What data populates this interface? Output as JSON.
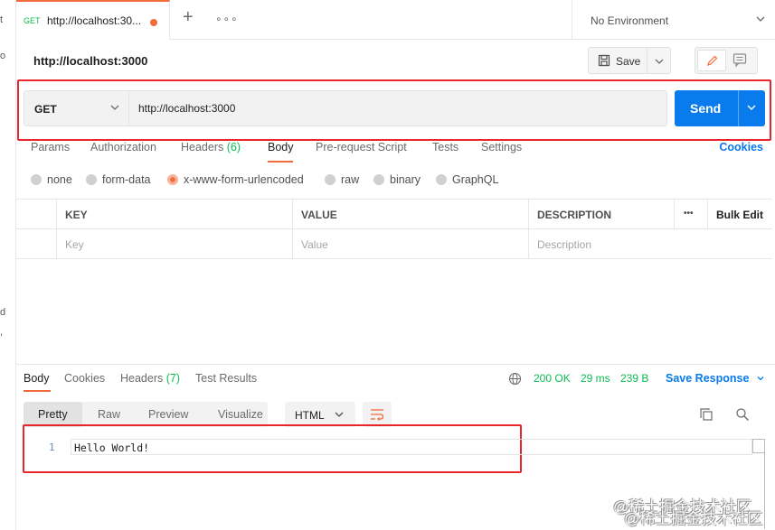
{
  "tab": {
    "method": "GET",
    "title": "http://localhost:30..."
  },
  "environment": {
    "label": "No Environment"
  },
  "request": {
    "title": "http://localhost:3000",
    "save_label": "Save",
    "method": "GET",
    "url": "http://localhost:3000",
    "send_label": "Send"
  },
  "req_tabs": {
    "params": "Params",
    "authorization": "Authorization",
    "headers": "Headers",
    "headers_count": "(6)",
    "body": "Body",
    "prerequest": "Pre-request Script",
    "tests": "Tests",
    "settings": "Settings",
    "cookies": "Cookies"
  },
  "body_types": {
    "none": "none",
    "form_data": "form-data",
    "urlencoded": "x-www-form-urlencoded",
    "raw": "raw",
    "binary": "binary",
    "graphql": "GraphQL",
    "selected": "x-www-form-urlencoded"
  },
  "kv_table": {
    "headers": {
      "key": "KEY",
      "value": "VALUE",
      "description": "DESCRIPTION",
      "more": "•••",
      "bulk": "Bulk Edit"
    },
    "placeholders": {
      "key": "Key",
      "value": "Value",
      "description": "Description"
    }
  },
  "response": {
    "tabs": {
      "body": "Body",
      "cookies": "Cookies",
      "headers": "Headers",
      "headers_count": "(7)",
      "tests": "Test Results"
    },
    "status": "200 OK",
    "time": "29 ms",
    "size": "239 B",
    "save_response": "Save Response",
    "views": {
      "pretty": "Pretty",
      "raw": "Raw",
      "preview": "Preview",
      "visualize": "Visualize"
    },
    "format": "HTML",
    "line_number": "1",
    "code_line": "Hello World!"
  },
  "left_fragments": {
    "a": "t",
    "b": "o",
    "c": "d",
    "d": ","
  },
  "watermark": "@稀土掘金技术社区",
  "colors": {
    "accent_orange": "#f26b3a",
    "send_blue": "#097bed",
    "status_green": "#0cbb52",
    "highlight_red": "#e8262b"
  }
}
